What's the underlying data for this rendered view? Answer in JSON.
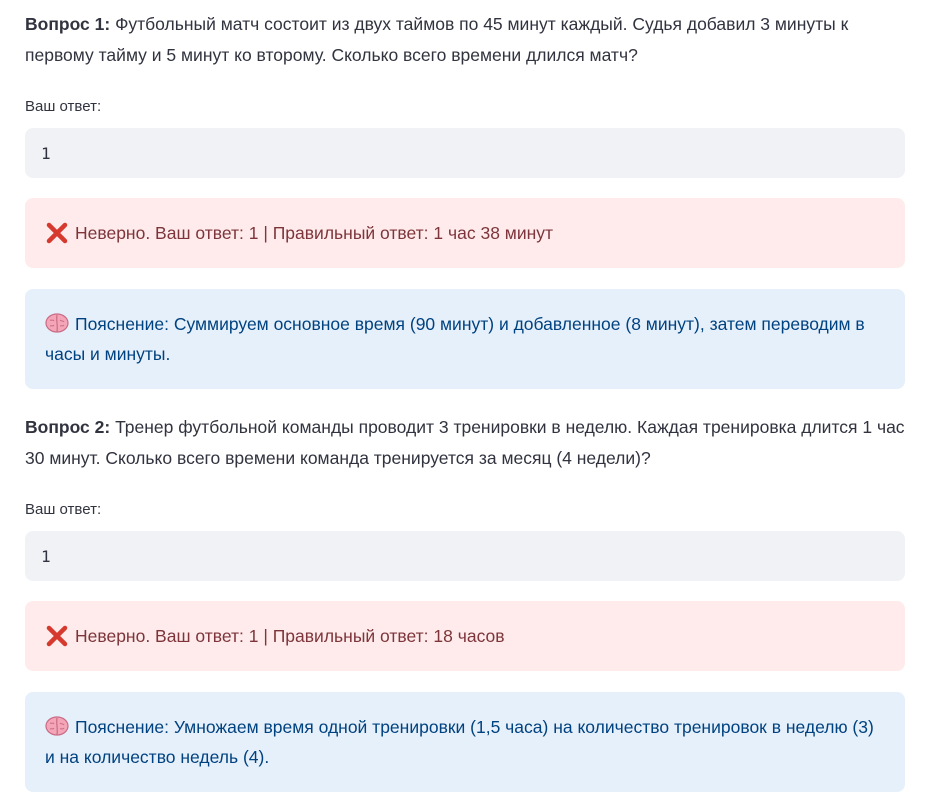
{
  "questions": [
    {
      "title": "Вопрос 1:",
      "text": " Футбольный матч состоит из двух таймов по 45 минут каждый. Судья добавил 3 минуты к первому тайму и 5 минут ко второму. Сколько всего времени длился матч?",
      "answer_label": "Ваш ответ:",
      "answer_value": "1",
      "error_text": "Неверно. Ваш ответ: 1 | Правильный ответ: 1 час 38 минут",
      "error_icon": "cross-mark-icon",
      "info_text": "Пояснение: Суммируем основное время (90 минут) и добавленное (8 минут), затем переводим в часы и минуты.",
      "info_icon": "brain-icon"
    },
    {
      "title": "Вопрос 2:",
      "text": " Тренер футбольной команды проводит 3 тренировки в неделю. Каждая тренировка длится 1 час 30 минут. Сколько всего времени команда тренируется за месяц (4 недели)?",
      "answer_label": "Ваш ответ:",
      "answer_value": "1",
      "error_text": "Неверно. Ваш ответ: 1 | Правильный ответ: 18 часов",
      "error_icon": "cross-mark-icon",
      "info_text": "Пояснение: Умножаем время одной тренировки (1,5 часа) на количество тренировок в неделю (3) и на количество недель (4).",
      "info_icon": "brain-icon"
    }
  ],
  "colors": {
    "error_bg": "#ffebeb",
    "error_text": "#7d353b",
    "info_bg": "#e6f0fb",
    "info_text": "#004280",
    "input_bg": "#f0f2f6",
    "cross": "#e0382b"
  }
}
